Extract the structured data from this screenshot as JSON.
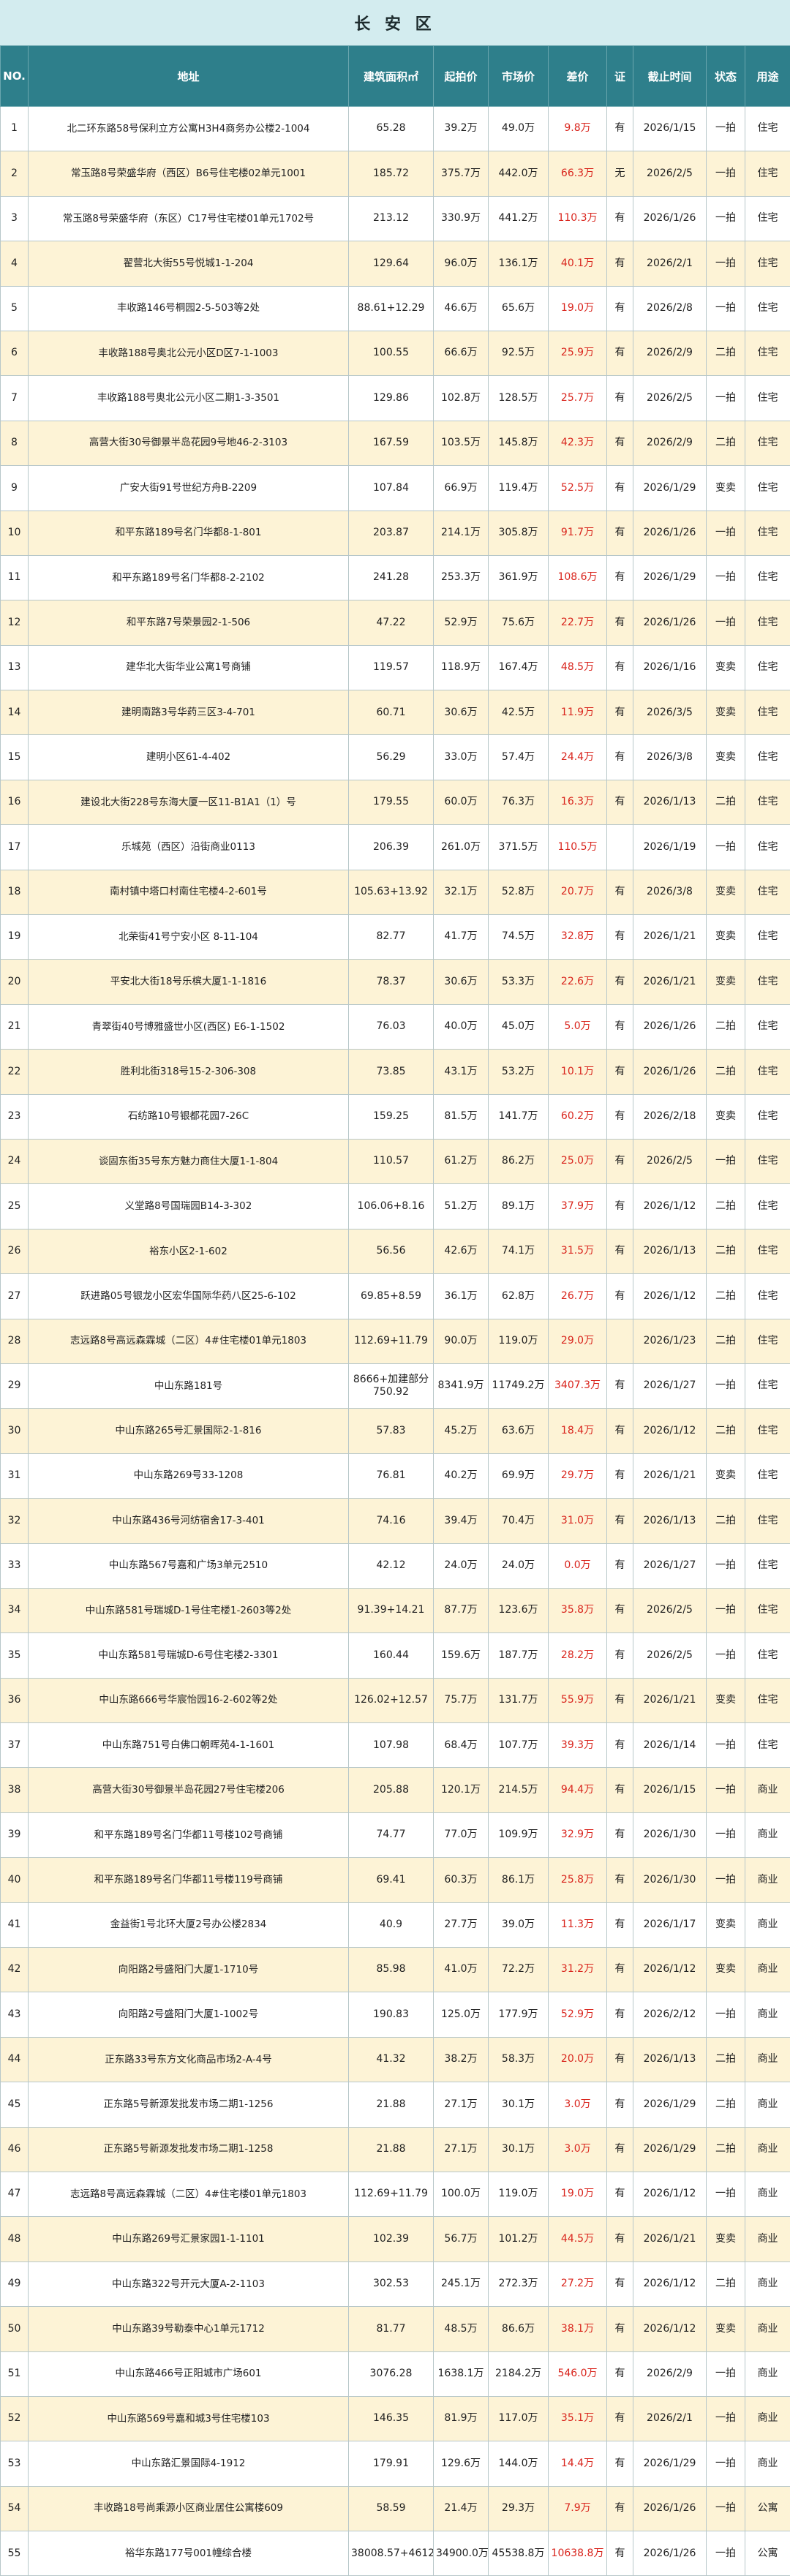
{
  "title": "长 安 区",
  "headers": [
    "NO.",
    "地址",
    "建筑面积㎡",
    "起拍价",
    "市场价",
    "差价",
    "证",
    "截止时间",
    "状态",
    "用途"
  ],
  "rows": [
    [
      "1",
      "北二环东路58号保利立方公寓H3H4商务办公楼2-1004",
      "65.28",
      "39.2万",
      "49.0万",
      "9.8万",
      "有",
      "2026/1/15",
      "一拍",
      "住宅"
    ],
    [
      "2",
      "常玉路8号荣盛华府（西区）B6号住宅楼02单元1001",
      "185.72",
      "375.7万",
      "442.0万",
      "66.3万",
      "无",
      "2026/2/5",
      "一拍",
      "住宅"
    ],
    [
      "3",
      "常玉路8号荣盛华府（东区）C17号住宅楼01单元1702号",
      "213.12",
      "330.9万",
      "441.2万",
      "110.3万",
      "有",
      "2026/1/26",
      "一拍",
      "住宅"
    ],
    [
      "4",
      "翟营北大街55号悦城1-1-204",
      "129.64",
      "96.0万",
      "136.1万",
      "40.1万",
      "有",
      "2026/2/1",
      "一拍",
      "住宅"
    ],
    [
      "5",
      "丰收路146号桐园2-5-503等2处",
      "88.61+12.29",
      "46.6万",
      "65.6万",
      "19.0万",
      "有",
      "2026/2/8",
      "一拍",
      "住宅"
    ],
    [
      "6",
      "丰收路188号奥北公元小区D区7-1-1003",
      "100.55",
      "66.6万",
      "92.5万",
      "25.9万",
      "有",
      "2026/2/9",
      "二拍",
      "住宅"
    ],
    [
      "7",
      "丰收路188号奥北公元小区二期1-3-3501",
      "129.86",
      "102.8万",
      "128.5万",
      "25.7万",
      "有",
      "2026/2/5",
      "一拍",
      "住宅"
    ],
    [
      "8",
      "高营大街30号御景半岛花园9号地46-2-3103",
      "167.59",
      "103.5万",
      "145.8万",
      "42.3万",
      "有",
      "2026/2/9",
      "二拍",
      "住宅"
    ],
    [
      "9",
      "广安大街91号世纪方舟B-2209",
      "107.84",
      "66.9万",
      "119.4万",
      "52.5万",
      "有",
      "2026/1/29",
      "变卖",
      "住宅"
    ],
    [
      "10",
      "和平东路189号名门华都8-1-801",
      "203.87",
      "214.1万",
      "305.8万",
      "91.7万",
      "有",
      "2026/1/26",
      "一拍",
      "住宅"
    ],
    [
      "11",
      "和平东路189号名门华都8-2-2102",
      "241.28",
      "253.3万",
      "361.9万",
      "108.6万",
      "有",
      "2026/1/29",
      "一拍",
      "住宅"
    ],
    [
      "12",
      "和平东路7号荣景园2-1-506",
      "47.22",
      "52.9万",
      "75.6万",
      "22.7万",
      "有",
      "2026/1/26",
      "一拍",
      "住宅"
    ],
    [
      "13",
      "建华北大街华业公寓1号商铺",
      "119.57",
      "118.9万",
      "167.4万",
      "48.5万",
      "有",
      "2026/1/16",
      "变卖",
      "住宅"
    ],
    [
      "14",
      "建明南路3号华药三区3-4-701",
      "60.71",
      "30.6万",
      "42.5万",
      "11.9万",
      "有",
      "2026/3/5",
      "变卖",
      "住宅"
    ],
    [
      "15",
      "建明小区61-4-402",
      "56.29",
      "33.0万",
      "57.4万",
      "24.4万",
      "有",
      "2026/3/8",
      "变卖",
      "住宅"
    ],
    [
      "16",
      "建设北大街228号东海大厦一区11-B1A1（1）号",
      "179.55",
      "60.0万",
      "76.3万",
      "16.3万",
      "有",
      "2026/1/13",
      "二拍",
      "住宅"
    ],
    [
      "17",
      "乐城苑（西区）沿街商业0113",
      "206.39",
      "261.0万",
      "371.5万",
      "110.5万",
      "",
      "2026/1/19",
      "一拍",
      "住宅"
    ],
    [
      "18",
      "南村镇中塔口村南住宅楼4-2-601号",
      "105.63+13.92",
      "32.1万",
      "52.8万",
      "20.7万",
      "有",
      "2026/3/8",
      "变卖",
      "住宅"
    ],
    [
      "19",
      "北荣街41号宁安小区 8-11-104",
      "82.77",
      "41.7万",
      "74.5万",
      "32.8万",
      "有",
      "2026/1/21",
      "变卖",
      "住宅"
    ],
    [
      "20",
      "平安北大街18号乐槟大厦1-1-1816",
      "78.37",
      "30.6万",
      "53.3万",
      "22.6万",
      "有",
      "2026/1/21",
      "变卖",
      "住宅"
    ],
    [
      "21",
      "青翠街40号博雅盛世小区(西区) E6-1-1502",
      "76.03",
      "40.0万",
      "45.0万",
      "5.0万",
      "有",
      "2026/1/26",
      "二拍",
      "住宅"
    ],
    [
      "22",
      "胜利北街318号15-2-306-308",
      "73.85",
      "43.1万",
      "53.2万",
      "10.1万",
      "有",
      "2026/1/26",
      "二拍",
      "住宅"
    ],
    [
      "23",
      "石纺路10号银都花园7-26C",
      "159.25",
      "81.5万",
      "141.7万",
      "60.2万",
      "有",
      "2026/2/18",
      "变卖",
      "住宅"
    ],
    [
      "24",
      "谈固东街35号东方魅力商住大厦1-1-804",
      "110.57",
      "61.2万",
      "86.2万",
      "25.0万",
      "有",
      "2026/2/5",
      "一拍",
      "住宅"
    ],
    [
      "25",
      "义堂路8号国瑞园B14-3-302",
      "106.06+8.16",
      "51.2万",
      "89.1万",
      "37.9万",
      "有",
      "2026/1/12",
      "二拍",
      "住宅"
    ],
    [
      "26",
      "裕东小区2-1-602",
      "56.56",
      "42.6万",
      "74.1万",
      "31.5万",
      "有",
      "2026/1/13",
      "二拍",
      "住宅"
    ],
    [
      "27",
      "跃进路05号银龙小区宏华国际华药八区25-6-102",
      "69.85+8.59",
      "36.1万",
      "62.8万",
      "26.7万",
      "有",
      "2026/1/12",
      "二拍",
      "住宅"
    ],
    [
      "28",
      "志远路8号高远森霖城（二区）4#住宅楼01单元1803",
      "112.69+11.79",
      "90.0万",
      "119.0万",
      "29.0万",
      "",
      "2026/1/23",
      "二拍",
      "住宅"
    ],
    [
      "29",
      "中山东路181号",
      "8666+加建部分 750.92",
      "8341.9万",
      "11749.2万",
      "3407.3万",
      "有",
      "2026/1/27",
      "一拍",
      "住宅"
    ],
    [
      "30",
      "中山东路265号汇景国际2-1-816",
      "57.83",
      "45.2万",
      "63.6万",
      "18.4万",
      "有",
      "2026/1/12",
      "二拍",
      "住宅"
    ],
    [
      "31",
      "中山东路269号33-1208",
      "76.81",
      "40.2万",
      "69.9万",
      "29.7万",
      "有",
      "2026/1/21",
      "变卖",
      "住宅"
    ],
    [
      "32",
      "中山东路436号河纺宿舍17-3-401",
      "74.16",
      "39.4万",
      "70.4万",
      "31.0万",
      "有",
      "2026/1/13",
      "二拍",
      "住宅"
    ],
    [
      "33",
      "中山东路567号嘉和广场3单元2510",
      "42.12",
      "24.0万",
      "24.0万",
      "0.0万",
      "有",
      "2026/1/27",
      "一拍",
      "住宅"
    ],
    [
      "34",
      "中山东路581号瑞城D-1号住宅楼1-2603等2处",
      "91.39+14.21",
      "87.7万",
      "123.6万",
      "35.8万",
      "有",
      "2026/2/5",
      "一拍",
      "住宅"
    ],
    [
      "35",
      "中山东路581号瑞城D-6号住宅楼2-3301",
      "160.44",
      "159.6万",
      "187.7万",
      "28.2万",
      "有",
      "2026/2/5",
      "一拍",
      "住宅"
    ],
    [
      "36",
      "中山东路666号华宸怡园16-2-602等2处",
      "126.02+12.57",
      "75.7万",
      "131.7万",
      "55.9万",
      "有",
      "2026/1/21",
      "变卖",
      "住宅"
    ],
    [
      "37",
      "中山东路751号白佛口朝晖苑4-1-1601",
      "107.98",
      "68.4万",
      "107.7万",
      "39.3万",
      "有",
      "2026/1/14",
      "一拍",
      "住宅"
    ],
    [
      "38",
      "高营大街30号御景半岛花园27号住宅楼206",
      "205.88",
      "120.1万",
      "214.5万",
      "94.4万",
      "有",
      "2026/1/15",
      "一拍",
      "商业"
    ],
    [
      "39",
      "和平东路189号名门华都11号楼102号商铺",
      "74.77",
      "77.0万",
      "109.9万",
      "32.9万",
      "有",
      "2026/1/30",
      "一拍",
      "商业"
    ],
    [
      "40",
      "和平东路189号名门华都11号楼119号商铺",
      "69.41",
      "60.3万",
      "86.1万",
      "25.8万",
      "有",
      "2026/1/30",
      "一拍",
      "商业"
    ],
    [
      "41",
      "金益街1号北环大厦2号办公楼2834",
      "40.9",
      "27.7万",
      "39.0万",
      "11.3万",
      "有",
      "2026/1/17",
      "变卖",
      "商业"
    ],
    [
      "42",
      "向阳路2号盛阳门大厦1-1710号",
      "85.98",
      "41.0万",
      "72.2万",
      "31.2万",
      "有",
      "2026/1/12",
      "变卖",
      "商业"
    ],
    [
      "43",
      "向阳路2号盛阳门大厦1-1002号",
      "190.83",
      "125.0万",
      "177.9万",
      "52.9万",
      "有",
      "2026/2/12",
      "一拍",
      "商业"
    ],
    [
      "44",
      "正东路33号东方文化商品市场2-A-4号",
      "41.32",
      "38.2万",
      "58.3万",
      "20.0万",
      "有",
      "2026/1/13",
      "二拍",
      "商业"
    ],
    [
      "45",
      "正东路5号新源发批发市场二期1-1256",
      "21.88",
      "27.1万",
      "30.1万",
      "3.0万",
      "有",
      "2026/1/29",
      "二拍",
      "商业"
    ],
    [
      "46",
      "正东路5号新源发批发市场二期1-1258",
      "21.88",
      "27.1万",
      "30.1万",
      "3.0万",
      "有",
      "2026/1/29",
      "二拍",
      "商业"
    ],
    [
      "47",
      "志远路8号高远森霖城（二区）4#住宅楼01单元1803",
      "112.69+11.79",
      "100.0万",
      "119.0万",
      "19.0万",
      "有",
      "2026/1/12",
      "一拍",
      "商业"
    ],
    [
      "48",
      "中山东路269号汇景家园1-1-1101",
      "102.39",
      "56.7万",
      "101.2万",
      "44.5万",
      "有",
      "2026/1/21",
      "变卖",
      "商业"
    ],
    [
      "49",
      "中山东路322号开元大厦A-2-1103",
      "302.53",
      "245.1万",
      "272.3万",
      "27.2万",
      "有",
      "2026/1/12",
      "二拍",
      "商业"
    ],
    [
      "50",
      "中山东路39号勒泰中心1单元1712",
      "81.77",
      "48.5万",
      "86.6万",
      "38.1万",
      "有",
      "2026/1/12",
      "变卖",
      "商业"
    ],
    [
      "51",
      "中山东路466号正阳城市广场601",
      "3076.28",
      "1638.1万",
      "2184.2万",
      "546.0万",
      "有",
      "2026/2/9",
      "一拍",
      "商业"
    ],
    [
      "52",
      "中山东路569号嘉和城3号住宅楼103",
      "146.35",
      "81.9万",
      "117.0万",
      "35.1万",
      "有",
      "2026/2/1",
      "一拍",
      "商业"
    ],
    [
      "53",
      "中山东路汇景国际4-1912",
      "179.91",
      "129.6万",
      "144.0万",
      "14.4万",
      "有",
      "2026/1/29",
      "一拍",
      "商业"
    ],
    [
      "54",
      "丰收路18号尚乘源小区商业居住公寓楼609",
      "58.59",
      "21.4万",
      "29.3万",
      "7.9万",
      "有",
      "2026/1/26",
      "一拍",
      "公寓"
    ],
    [
      "55",
      "裕华东路177号001幢综合楼",
      "38008.57+4612",
      "34900.0万",
      "45538.8万",
      "10638.8万",
      "有",
      "2026/1/26",
      "一拍",
      "公寓"
    ]
  ]
}
